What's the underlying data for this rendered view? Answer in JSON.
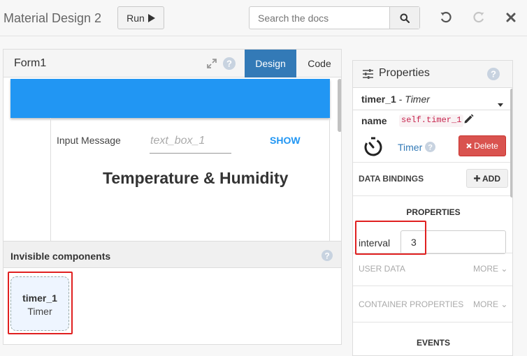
{
  "app": {
    "title": "Material Design 2"
  },
  "toolbar": {
    "run_label": "Run"
  },
  "search": {
    "placeholder": "Search the docs"
  },
  "form_panel": {
    "title": "Form1",
    "tabs": [
      {
        "label": "Design",
        "active": true
      },
      {
        "label": "Code",
        "active": false
      }
    ],
    "canvas": {
      "input_label": "Input Message",
      "input_placeholder": "text_box_1",
      "show_button": "SHOW",
      "heading": "Temperature & Humidity"
    },
    "invisible_components": {
      "title": "Invisible components",
      "items": [
        {
          "name": "timer_1",
          "type": "Timer"
        }
      ]
    }
  },
  "properties_panel": {
    "title": "Properties",
    "component": {
      "name": "timer_1",
      "separator": " - ",
      "type": "Timer"
    },
    "name_label": "name",
    "name_value": "self.timer_1",
    "type_label": "Timer",
    "delete_label": "Delete",
    "data_bindings_label": "DATA BINDINGS",
    "add_label": "ADD",
    "properties_heading": "PROPERTIES",
    "interval_label": "interval",
    "interval_value": "3",
    "user_data_label": "USER DATA",
    "container_properties_label": "CONTAINER PROPERTIES",
    "more_label": "MORE",
    "events_heading": "EVENTS"
  },
  "colors": {
    "accent_blue": "#337ab7",
    "material_blue": "#2196f3",
    "delete_red": "#d9534f",
    "highlight_red": "#e02020"
  }
}
